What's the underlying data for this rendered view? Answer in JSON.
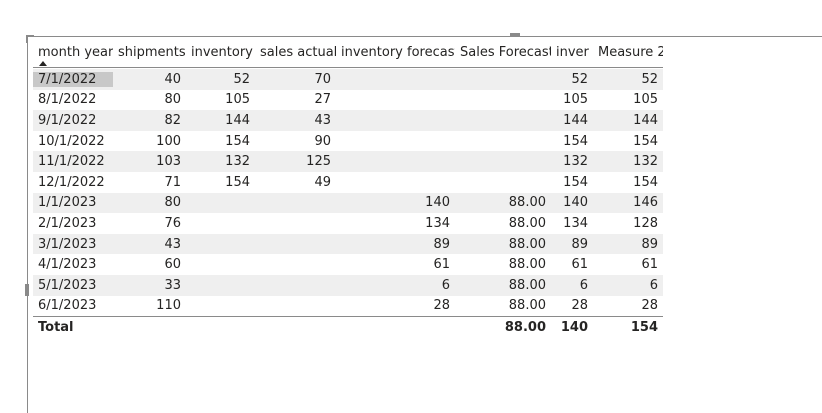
{
  "table": {
    "columns": [
      "month year",
      "shipments",
      "inventory",
      "sales actual",
      "inventory forecast",
      "Sales Forecast",
      "inver",
      "Measure 2"
    ],
    "rows": [
      [
        "7/1/2022",
        "40",
        "52",
        "70",
        "",
        "",
        "52",
        "52"
      ],
      [
        "8/1/2022",
        "80",
        "105",
        "27",
        "",
        "",
        "105",
        "105"
      ],
      [
        "9/1/2022",
        "82",
        "144",
        "43",
        "",
        "",
        "144",
        "144"
      ],
      [
        "10/1/2022",
        "100",
        "154",
        "90",
        "",
        "",
        "154",
        "154"
      ],
      [
        "11/1/2022",
        "103",
        "132",
        "125",
        "",
        "",
        "132",
        "132"
      ],
      [
        "12/1/2022",
        "71",
        "154",
        "49",
        "",
        "",
        "154",
        "154"
      ],
      [
        "1/1/2023",
        "80",
        "",
        "",
        "140",
        "88.00",
        "140",
        "146"
      ],
      [
        "2/1/2023",
        "76",
        "",
        "",
        "134",
        "88.00",
        "134",
        "128"
      ],
      [
        "3/1/2023",
        "43",
        "",
        "",
        "89",
        "88.00",
        "89",
        "89"
      ],
      [
        "4/1/2023",
        "60",
        "",
        "",
        "61",
        "88.00",
        "61",
        "61"
      ],
      [
        "5/1/2023",
        "33",
        "",
        "",
        "6",
        "88.00",
        "6",
        "6"
      ],
      [
        "6/1/2023",
        "110",
        "",
        "",
        "28",
        "88.00",
        "28",
        "28"
      ]
    ],
    "total": [
      "Total",
      "",
      "",
      "",
      "",
      "88.00",
      "140",
      "154"
    ]
  }
}
